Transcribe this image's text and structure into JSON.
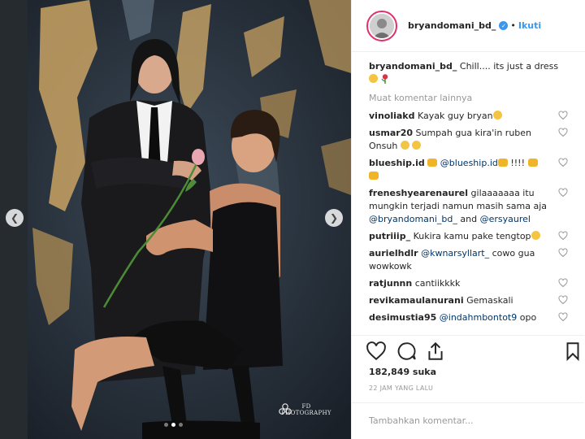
{
  "post": {
    "username": "bryandomani_bd_",
    "verified": true,
    "separator": "•",
    "follow_label": "Ikuti",
    "caption": "Chill.... its just a dress",
    "load_more": "Muat komentar lainnya",
    "likes": "182,849 suka",
    "timestamp": "22 JAM YANG LALU",
    "add_comment_placeholder": "Tambahkan komentar..."
  },
  "comments": [
    {
      "user": "vinoliakd",
      "text": "Kayak guy bryan"
    },
    {
      "user": "usmar20",
      "text": "Sumpah gua kira'in ruben Onsuh"
    },
    {
      "user": "blueship.id",
      "mention": "@blueship.id",
      "text": "!!!!"
    },
    {
      "user": "freneshyearenaurel",
      "text": "gilaaaaaaa itu mungkin terjadi namun masih sama aja",
      "mention": "@bryandomani_bd_",
      "joiner": "and",
      "mention2": "@ersyaurel"
    },
    {
      "user": "putriiip_",
      "text": "Kukira kamu pake tengtop"
    },
    {
      "user": "aurielhdlr",
      "mention": "@kwnarsyllart_",
      "text": "cowo gua wowkowk"
    },
    {
      "user": "ratjunnn",
      "text": "cantiikkkk"
    },
    {
      "user": "revikamaulanurani",
      "text": "Gemaskali"
    },
    {
      "user": "desimustia95",
      "mention": "@indahmbontot9",
      "text": "opo"
    }
  ],
  "photo": {
    "watermark": "FD PHOTOGRAPHY",
    "slide_count": 3,
    "active_slide": 2
  },
  "icons": {
    "like": "heart-icon",
    "comment": "speech-bubble-icon",
    "share": "share-icon",
    "save": "bookmark-icon",
    "prev": "chevron-left-icon",
    "next": "chevron-right-icon"
  },
  "colors": {
    "link": "#3897f0",
    "mention": "#003569",
    "muted": "#999999",
    "text": "#262626"
  }
}
